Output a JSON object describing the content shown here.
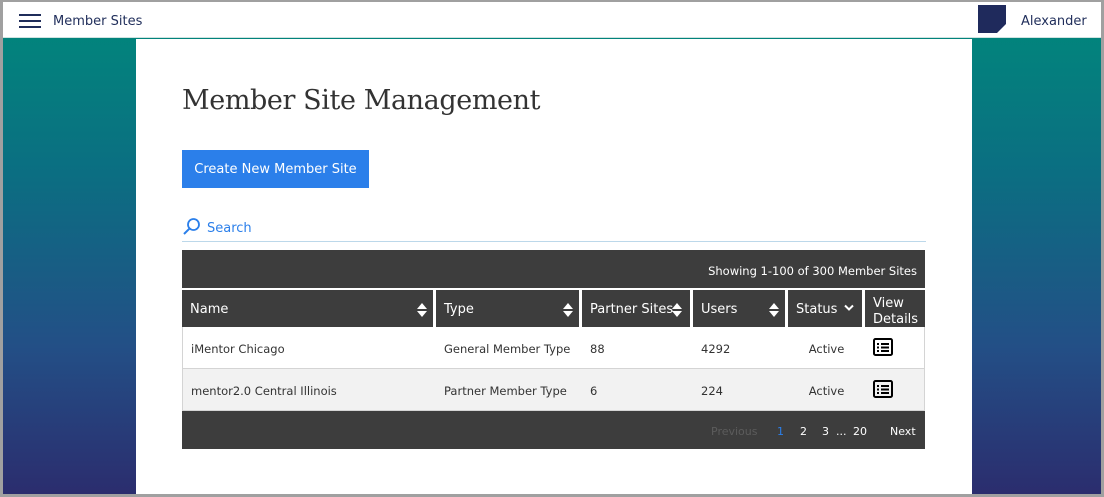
{
  "header": {
    "app_title": "Member Sites",
    "user_name": "Alexander",
    "icons": {
      "menu": "hamburger-menu-icon",
      "avatar": "user-avatar-icon"
    }
  },
  "page": {
    "title": "Member Site Management",
    "create_button_label": "Create New Member Site",
    "search_label": "Search"
  },
  "table": {
    "showing_text": "Showing 1-100 of 300 Member Sites",
    "columns": [
      "Name",
      "Type",
      "Partner Sites",
      "Users",
      "Status",
      "View Details"
    ],
    "rows": [
      {
        "name": "iMentor Chicago",
        "type": "General Member Type",
        "partner_sites": "88",
        "users": "4292",
        "status": "Active"
      },
      {
        "name": "mentor2.0 Central Illinois",
        "type": "Partner Member Type",
        "partner_sites": "6",
        "users": "224",
        "status": "Active"
      }
    ]
  },
  "pagination": {
    "previous": "Previous",
    "pages": [
      "1",
      "2",
      "3"
    ],
    "ellipsis": "...",
    "last_page": "20",
    "next": "Next",
    "current_page": "1"
  },
  "colors": {
    "accent": "#2b7fea",
    "navy": "#1f2d5a",
    "table_header": "#3d3d3d",
    "gradient_top": "#00897b",
    "gradient_bottom": "#2b2d6e"
  }
}
